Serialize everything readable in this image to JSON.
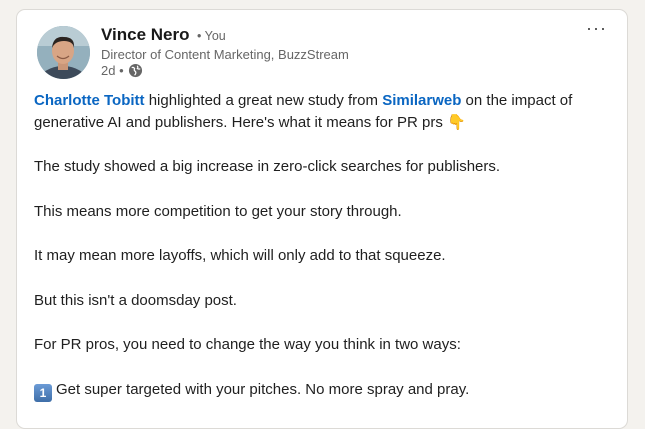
{
  "post": {
    "author": {
      "name": "Vince Nero",
      "relation": "• You",
      "title": "Director of Content Marketing, BuzzStream",
      "timestamp": "2d •",
      "visibility_icon": "globe-icon"
    },
    "menu_label": "···",
    "intro": {
      "mention1": "Charlotte Tobitt",
      "text1": " highlighted a great new study from ",
      "mention2": "Similarweb",
      "text2": " on the impact of generative AI and publishers. Here's what it means for PR prs 👇"
    },
    "paragraphs": [
      "The study showed a big increase in zero-click searches for publishers.",
      "This means more competition to get your story through.",
      "It may mean more layoffs, which will only add to that squeeze.",
      "But this isn't a doomsday post.",
      "For PR pros, you need to change the way you think in two ways:"
    ],
    "list_item_1": {
      "badge": "1",
      "text": "Get super targeted with your pitches. No more spray and pray."
    }
  },
  "colors": {
    "mention": "#0a66c2",
    "background": "#f4f2ee",
    "card": "#ffffff"
  }
}
